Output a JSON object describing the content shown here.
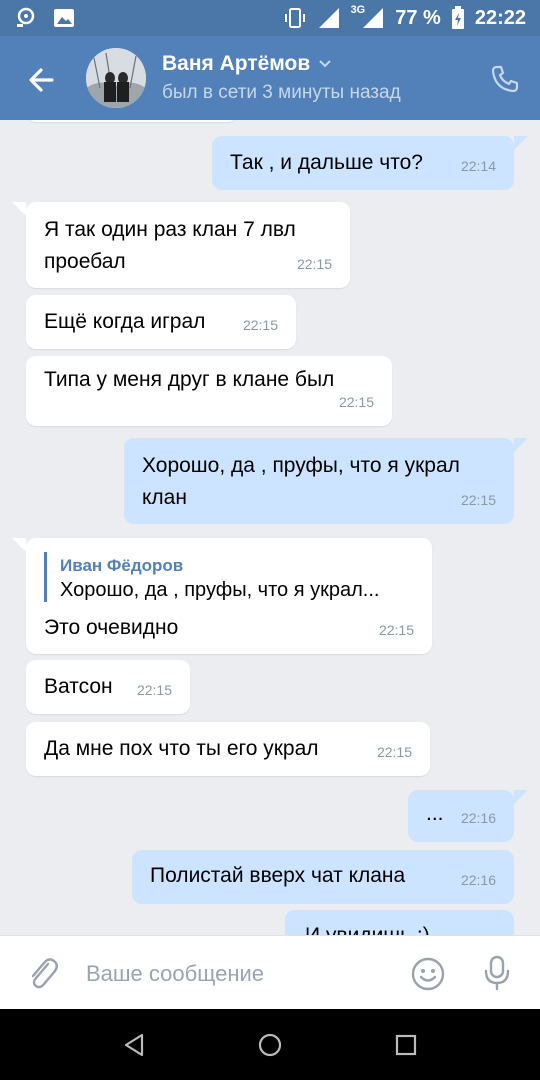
{
  "status_bar": {
    "icons_left": [
      "notification-icon",
      "image-icon"
    ],
    "icons_right": [
      "vibrate-icon",
      "signal-icon",
      "network-3g-icon",
      "battery-icon"
    ],
    "network": "3G",
    "battery": "77 %",
    "time": "22:22"
  },
  "header": {
    "contact_name": "Ваня Артёмов",
    "contact_status": "был в сети 3 минуты назад",
    "icons": [
      "back-arrow-icon",
      "chevron-down-icon",
      "phone-icon"
    ]
  },
  "messages": [
    {
      "direction": "out",
      "text": "Так , и дальше что?",
      "time": "22:14"
    },
    {
      "direction": "in",
      "text": "Я так один раз клан 7 лвл проебал",
      "time": "22:15"
    },
    {
      "direction": "in",
      "text": "Ещё когда играл",
      "time": "22:15"
    },
    {
      "direction": "in",
      "text": "Типа у меня друг в клане был",
      "time": "22:15"
    },
    {
      "direction": "out",
      "text": "Хорошо, да , пруфы, что я украл клан",
      "time": "22:15"
    },
    {
      "direction": "in",
      "reply": {
        "author": "Иван Фёдоров",
        "text": "Хорошо, да , пруфы, что я украл..."
      },
      "text": "Это очевидно",
      "time": "22:15"
    },
    {
      "direction": "in",
      "text": "Ватсон",
      "time": "22:15"
    },
    {
      "direction": "in",
      "text": "Да мне пох что ты его украл",
      "time": "22:15"
    },
    {
      "direction": "out",
      "text": "...",
      "time": "22:16"
    },
    {
      "direction": "out",
      "text": "Полистай вверх чат клана",
      "time": "22:16"
    },
    {
      "direction": "out",
      "text": "И увидишь :)",
      "time": ""
    }
  ],
  "input": {
    "placeholder": "Ваше сообщение",
    "icons": [
      "attach-icon",
      "sticker-icon",
      "microphone-icon"
    ]
  },
  "navbar": {
    "icons": [
      "nav-back-icon",
      "nav-home-icon",
      "nav-recents-icon"
    ]
  },
  "colors": {
    "header": "#5181b8",
    "status_bar": "#4a76a8",
    "incoming_bubble": "#ffffff",
    "outgoing_bubble": "#cce4ff",
    "chat_background": "#ebedf0",
    "accent": "#5181b8"
  }
}
